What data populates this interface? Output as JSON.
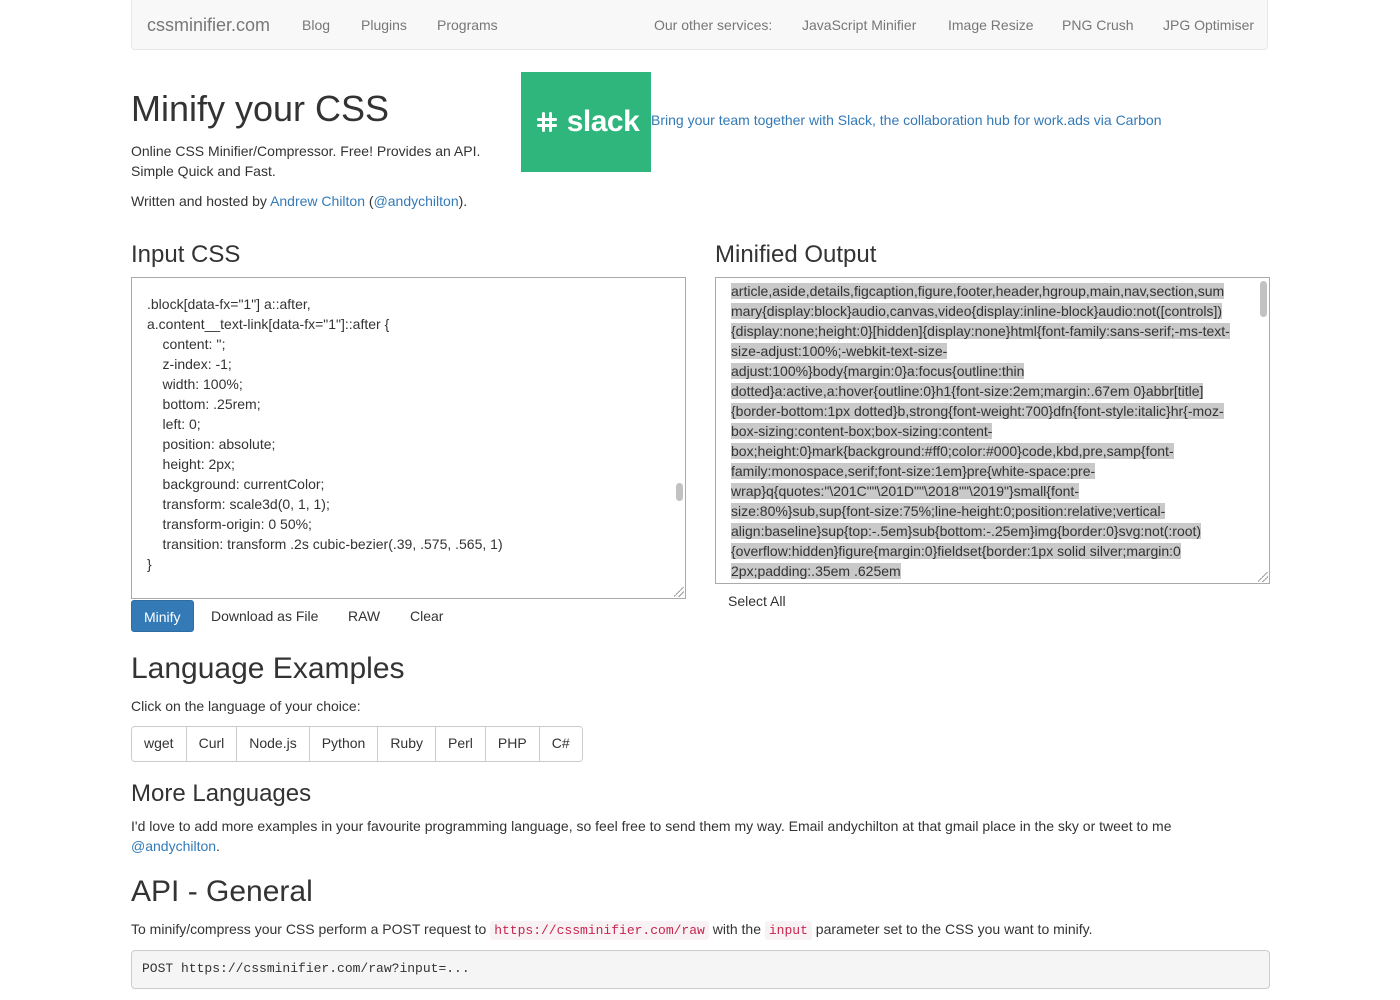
{
  "nav": {
    "brand": "cssminifier.com",
    "links": [
      "Blog",
      "Plugins",
      "Programs"
    ],
    "other_label": "Our other services:",
    "services": [
      "JavaScript Minifier",
      "Image Resize",
      "PNG Crush",
      "JPG Optimiser"
    ]
  },
  "header": {
    "title": "Minify your CSS",
    "tagline1": "Online CSS Minifier/Compressor. Free! Provides an API.",
    "tagline2": "Simple Quick and Fast.",
    "written_prefix": "Written and hosted by ",
    "author": "Andrew Chilton",
    "handle_open": " (",
    "handle": "@andychilton",
    "handle_close": ")."
  },
  "ad": {
    "logo_text": "slack",
    "text": "Bring your team together with Slack, the collaboration hub for work.ads via Carbon"
  },
  "input": {
    "heading": "Input CSS",
    "code": ".block[data-fx=\"1\"] a::after,\na.content__text-link[data-fx=\"1\"]::after {\n    content: '';\n    z-index: -1;\n    width: 100%;\n    bottom: .25rem;\n    left: 0;\n    position: absolute;\n    height: 2px;\n    background: currentColor;\n    transform: scale3d(0, 1, 1);\n    transform-origin: 0 50%;\n    transition: transform .2s cubic-bezier(.39, .575, .565, 1)\n}"
  },
  "output": {
    "heading": "Minified Output",
    "lines": [
      "article,aside,details,figcaption,figure,footer,header,hgroup,main,nav,section,sum",
      "mary{display:block}audio,canvas,video{display:inline-block}audio:not([controls])",
      "{display:none;height:0}[hidden]{display:none}html{font-family:sans-serif;-ms-text-",
      "size-adjust:100%;-webkit-text-size-",
      "adjust:100%}body{margin:0}a:focus{outline:thin",
      "dotted}a:active,a:hover{outline:0}h1{font-size:2em;margin:.67em 0}abbr[title]",
      "{border-bottom:1px dotted}b,strong{font-weight:700}dfn{font-style:italic}hr{-moz-",
      "box-sizing:content-box;box-sizing:content-",
      "box;height:0}mark{background:#ff0;color:#000}code,kbd,pre,samp{font-",
      "family:monospace,serif;font-size:1em}pre{white-space:pre-",
      "wrap}q{quotes:\"\\201C\"\"\\201D\"\"\\2018\"\"\\2019\"}small{font-",
      "size:80%}sub,sup{font-size:75%;line-height:0;position:relative;vertical-",
      "align:baseline}sup{top:-.5em}sub{bottom:-.25em}img{border:0}svg:not(:root)",
      "{overflow:hidden}figure{margin:0}fieldset{border:1px solid silver;margin:0",
      "2px;padding:.35em .625em"
    ],
    "select_all": "Select All"
  },
  "buttons": {
    "minify": "Minify",
    "download": "Download as File",
    "raw": "RAW",
    "clear": "Clear"
  },
  "examples": {
    "heading": "Language Examples",
    "prompt": "Click on the language of your choice:",
    "languages": [
      "wget",
      "Curl",
      "Node.js",
      "Python",
      "Ruby",
      "Perl",
      "PHP",
      "C#"
    ]
  },
  "more": {
    "heading": "More Languages",
    "text": "I'd love to add more examples in your favourite programming language, so feel free to send them my way. Email andychilton at that gmail place in the sky or tweet to me",
    "handle": "@andychilton",
    "end": "."
  },
  "api": {
    "heading": "API - General",
    "text1": "To minify/compress your CSS perform a POST request to ",
    "url": "https://cssminifier.com/raw",
    "text2": " with the ",
    "param": "input",
    "text3": " parameter set to the CSS you want to minify.",
    "example": "POST https://cssminifier.com/raw?input=..."
  },
  "colors": {
    "brand_blue": "#337ab7",
    "slack_green": "#2eb67d",
    "code_red": "#c7254e"
  }
}
